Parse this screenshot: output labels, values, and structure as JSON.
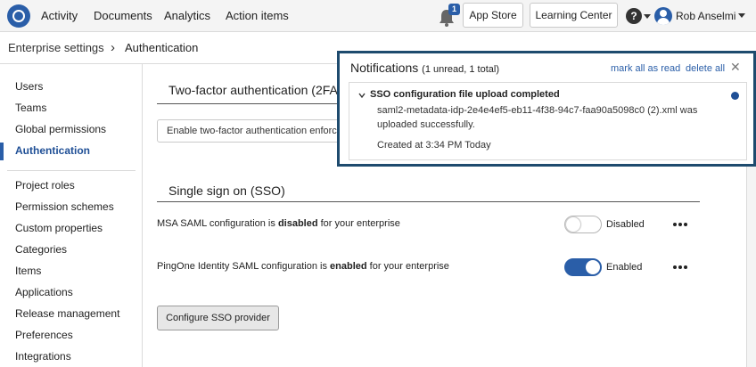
{
  "topbar": {
    "nav": [
      "Activity",
      "Documents",
      "Analytics",
      "Action items"
    ],
    "notification_count": "1",
    "app_store": "App Store",
    "learning_center": "Learning Center",
    "help_symbol": "?",
    "user_name": "Rob Anselmi"
  },
  "breadcrumb": {
    "parent": "Enterprise settings",
    "separator": "›",
    "current": "Authentication"
  },
  "sidebar": {
    "group1": [
      "Users",
      "Teams",
      "Global permissions",
      "Authentication"
    ],
    "active_item": "Authentication",
    "group2": [
      "Project roles",
      "Permission schemes",
      "Custom properties",
      "Categories",
      "Items",
      "Applications",
      "Release management",
      "Preferences",
      "Integrations"
    ]
  },
  "main": {
    "two_factor_title": "Two-factor authentication (2FA)",
    "two_factor_select": "Enable two-factor authentication enforcement",
    "sso_title": "Single sign on (SSO)",
    "sso_rows": [
      {
        "prefix": "MSA SAML configuration is ",
        "state_word": "disabled",
        "suffix": " for your enterprise",
        "toggle_label": "Disabled",
        "enabled": false
      },
      {
        "prefix": "PingOne Identity SAML configuration is ",
        "state_word": "enabled",
        "suffix": " for your enterprise",
        "toggle_label": "Enabled",
        "enabled": true
      }
    ],
    "configure_button": "Configure SSO provider"
  },
  "notifications": {
    "title": "Notifications",
    "summary": "(1 unread, 1 total)",
    "mark_all_read": "mark all as read",
    "delete_all": "delete all",
    "close_symbol": "✕",
    "item": {
      "title": "SSO configuration file upload completed",
      "body": "saml2-metadata-idp-2e4e4ef5-eb11-4f38-94c7-faa90a5098c0 (2).xml was uploaded successfully.",
      "created": "Created at 3:34 PM Today",
      "unread": true
    }
  },
  "colors": {
    "accent": "#2a5ea8",
    "active_text": "#1f4f96",
    "overlay_frame": "#1e4b6e"
  },
  "icons": {
    "logo": "app-logo-icon",
    "bell": "bell-icon",
    "help": "help-icon",
    "avatar": "avatar-icon",
    "kebab": "more-options-icon",
    "chevron": "chevron-down-icon",
    "close": "close-icon"
  }
}
